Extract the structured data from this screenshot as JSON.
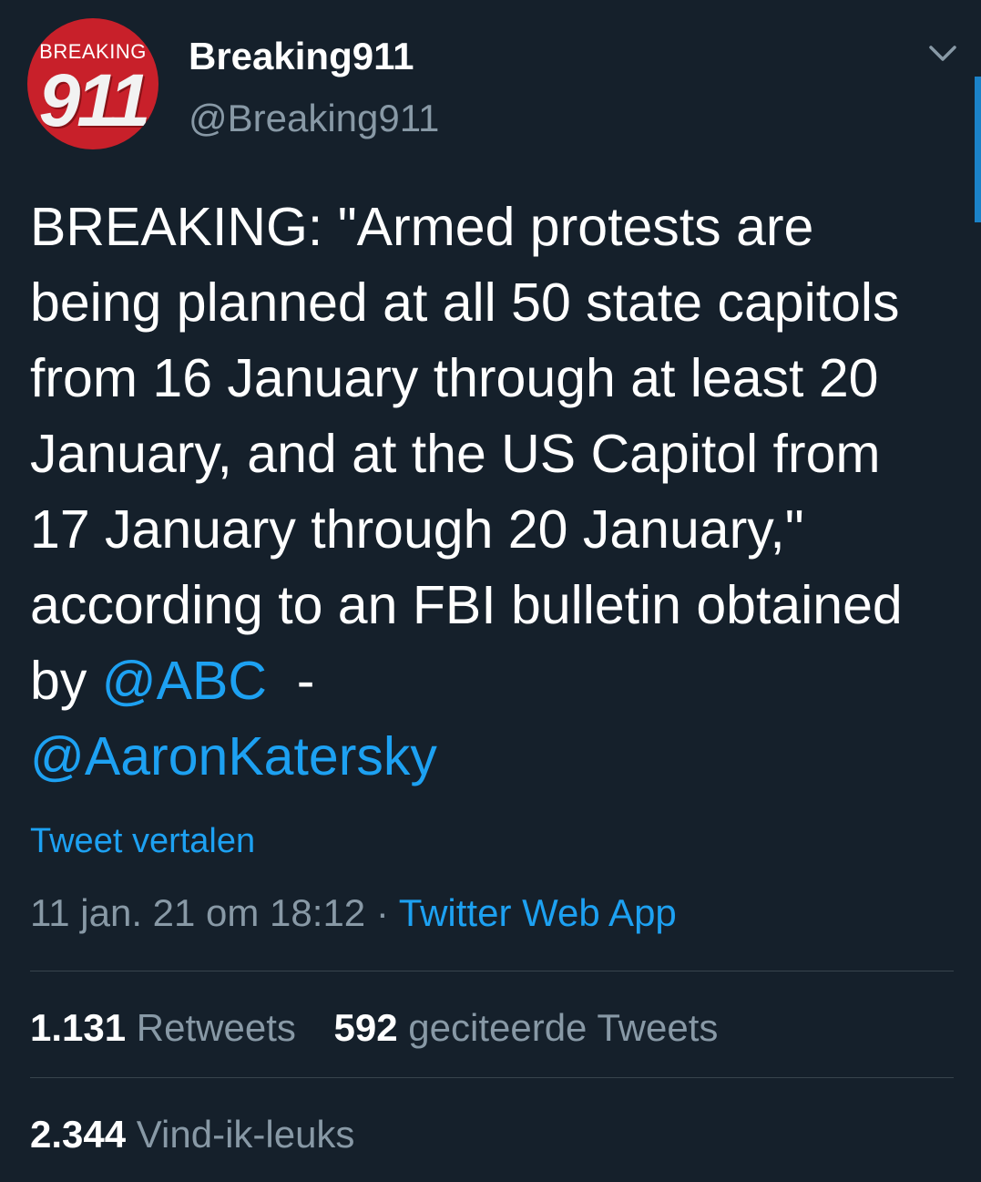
{
  "author": {
    "avatar_text_top": "BREAKING",
    "avatar_text_number": "911",
    "display_name": "Breaking911",
    "handle": "@Breaking911",
    "avatar_color": "#c8202a"
  },
  "tweet": {
    "text_parts": [
      "BREAKING: \"Armed protests are being planned at all 50 state capitols from 16 January through at least 20 January, and at the US Capitol from 17 January through 20 January,\" according to an FBI bulletin obtained by ",
      "@ABC",
      "  - ",
      "@AaronKatersky"
    ],
    "translate_label": "Tweet vertalen",
    "timestamp": "11 jan. 21 om 18:12",
    "separator": "·",
    "source": "Twitter Web App"
  },
  "stats": {
    "retweets_count": "1.131",
    "retweets_label": "Retweets",
    "quotes_count": "592",
    "quotes_label": "geciteerde Tweets",
    "likes_count": "2.344",
    "likes_label": "Vind-ik-leuks"
  },
  "icons": {
    "menu": "chevron-down-icon"
  },
  "colors": {
    "background": "#15202b",
    "accent": "#1da1f2",
    "secondary_text": "#8899a6"
  }
}
